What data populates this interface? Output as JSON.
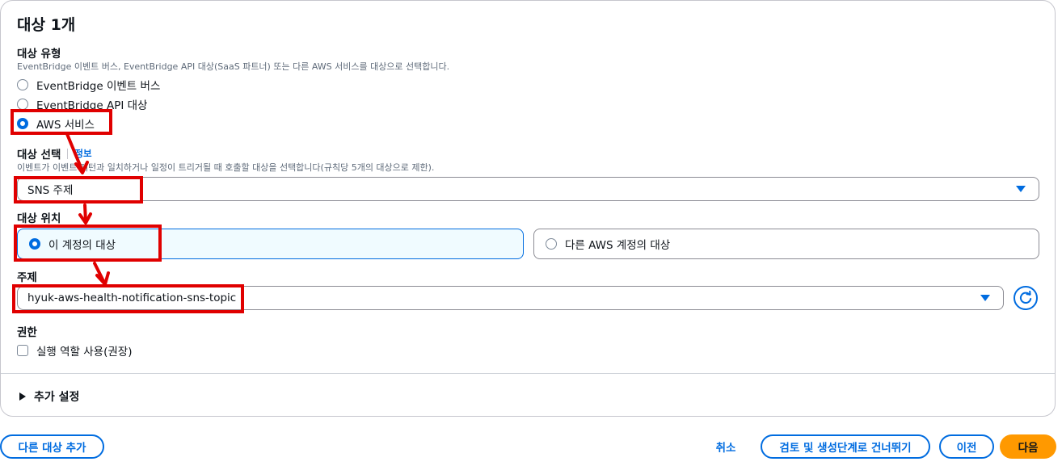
{
  "section": {
    "title": "대상 1개"
  },
  "target_type": {
    "label": "대상 유형",
    "description": "EventBridge 이벤트 버스, EventBridge API 대상(SaaS 파트너) 또는 다른 AWS 서비스를 대상으로 선택합니다.",
    "options": [
      {
        "label": "EventBridge 이벤트 버스",
        "selected": false
      },
      {
        "label": "EventBridge API 대상",
        "selected": false
      },
      {
        "label": "AWS 서비스",
        "selected": true
      }
    ]
  },
  "target_select": {
    "label": "대상 선택",
    "info": "정보",
    "description": "이벤트가 이벤트 패턴과 일치하거나 일정이 트리거될 때 호출할 대상을 선택합니다(규칙당 5개의 대상으로 제한).",
    "value": "SNS 주제"
  },
  "target_location": {
    "label": "대상 위치",
    "options": [
      {
        "label": "이 계정의 대상",
        "selected": true
      },
      {
        "label": "다른 AWS 계정의 대상",
        "selected": false
      }
    ]
  },
  "topic": {
    "label": "주제",
    "value": "hyuk-aws-health-notification-sns-topic"
  },
  "permissions": {
    "label": "권한",
    "checkbox_label": "실행 역할 사용(권장)",
    "checked": false
  },
  "additional_settings": {
    "label": "추가 설정"
  },
  "footer": {
    "add_target": "다른 대상 추가",
    "cancel": "취소",
    "skip_to_review": "검토 및 생성단계로 건너뛰기",
    "previous": "이전",
    "next": "다음"
  },
  "icons": {
    "refresh": "refresh-icon",
    "dropdown": "caret-down-icon",
    "expand": "caret-right-icon"
  },
  "colors": {
    "accent": "#006ce0",
    "primary_button": "#ff9900",
    "highlight": "#e00000"
  }
}
